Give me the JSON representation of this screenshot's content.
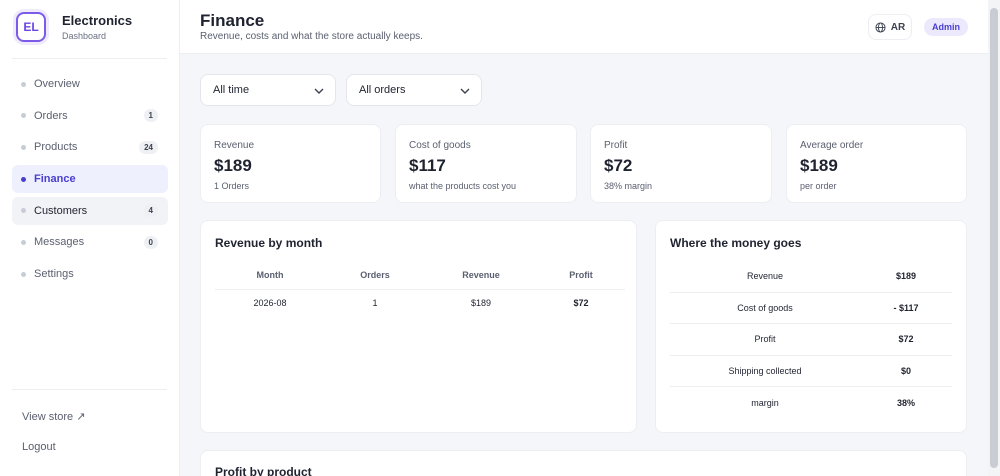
{
  "brand": {
    "logo": "EL",
    "name": "Electronics",
    "subtitle": "Dashboard"
  },
  "nav": [
    {
      "label": "Overview",
      "badge": ""
    },
    {
      "label": "Orders",
      "badge": "1"
    },
    {
      "label": "Products",
      "badge": "24"
    },
    {
      "label": "Finance",
      "badge": ""
    },
    {
      "label": "Customers",
      "badge": "4"
    },
    {
      "label": "Messages",
      "badge": "0"
    },
    {
      "label": "Settings",
      "badge": ""
    }
  ],
  "sidebar_footer": {
    "view_store": "View store ↗",
    "logout": "Logout"
  },
  "header": {
    "title": "Finance",
    "subtitle": "Revenue, costs and what the store actually keeps.",
    "language": "AR",
    "role": "Admin"
  },
  "filters": {
    "period": "All time",
    "orders": "All orders"
  },
  "stats": [
    {
      "label": "Revenue",
      "value": "$189",
      "sub": "1 Orders"
    },
    {
      "label": "Cost of goods",
      "value": "$117",
      "sub": "what the products cost you"
    },
    {
      "label": "Profit",
      "value": "$72",
      "sub": "38% margin"
    },
    {
      "label": "Average order",
      "value": "$189",
      "sub": "per order"
    }
  ],
  "revenue_by_month": {
    "title": "Revenue by month",
    "columns": [
      "Month",
      "Orders",
      "Revenue",
      "Profit"
    ],
    "rows": [
      [
        "2026-08",
        "1",
        "$189",
        "$72"
      ]
    ]
  },
  "money_goes": {
    "title": "Where the money goes",
    "rows": [
      {
        "label": "Revenue",
        "value": "$189"
      },
      {
        "label": "Cost of goods",
        "value": "- $117"
      },
      {
        "label": "Profit",
        "value": "$72"
      },
      {
        "label": "Shipping collected",
        "value": "$0"
      },
      {
        "label": "margin",
        "value": "38%"
      }
    ]
  },
  "profit_by_product": {
    "title": "Profit by product"
  },
  "colors": {
    "accent": "#4a3fd0",
    "brand_border": "#7c5ce6"
  },
  "icons": {
    "language": "globe-icon",
    "dropdown": "chevron-down-icon"
  }
}
